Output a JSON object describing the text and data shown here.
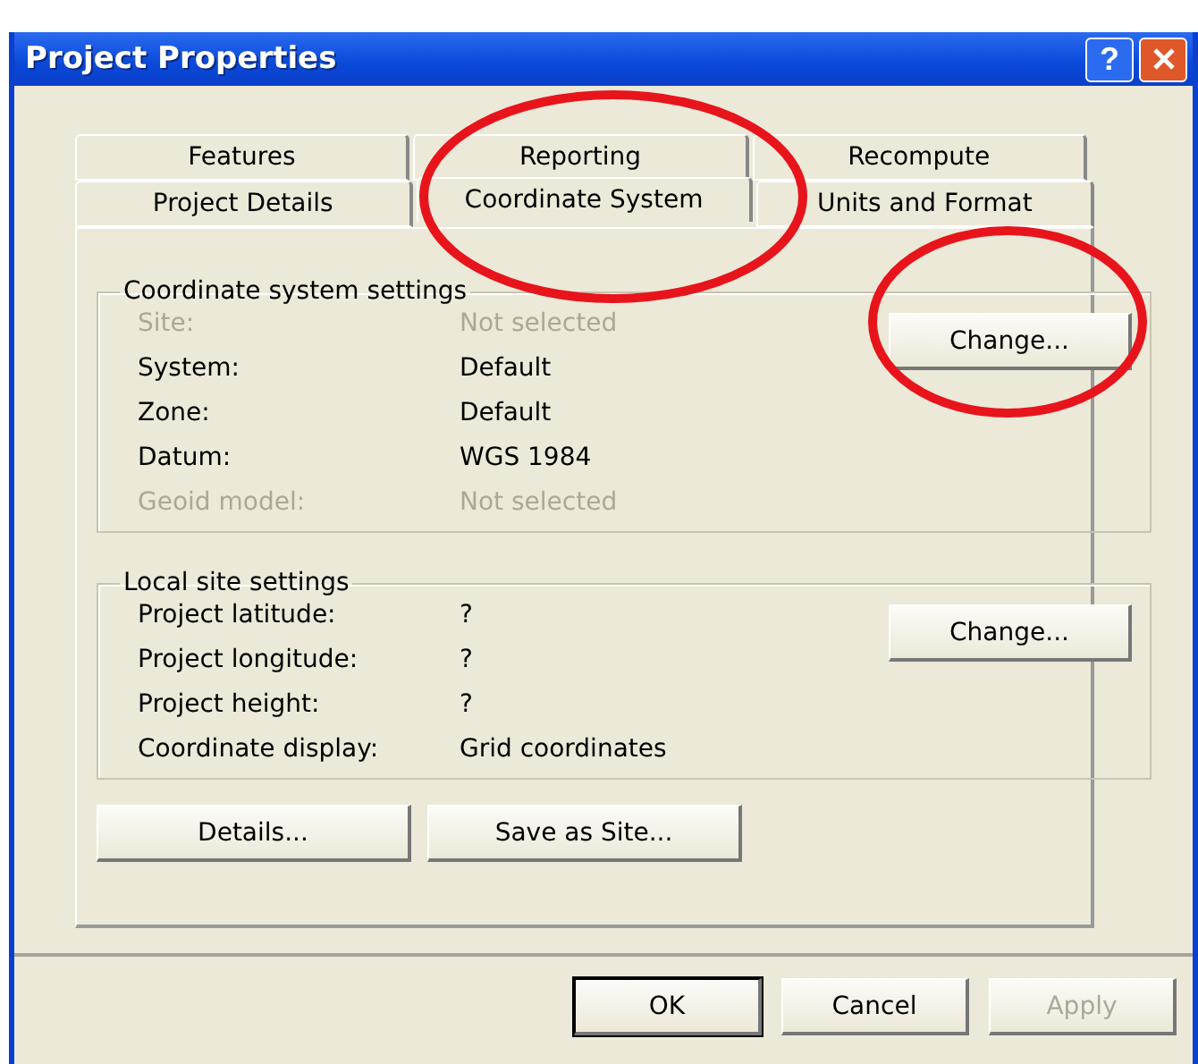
{
  "window": {
    "title": "Project Properties",
    "controls": [
      {
        "kind": "help",
        "label": "?"
      },
      {
        "kind": "close"
      }
    ]
  },
  "tab_rows": [
    [
      {
        "label": "Features",
        "selected": false
      },
      {
        "label": "Reporting",
        "selected": false
      },
      {
        "label": "Recompute",
        "selected": false
      }
    ],
    [
      {
        "label": "Project Details",
        "selected": false
      },
      {
        "label": "Coordinate System",
        "selected": true
      },
      {
        "label": "Units and Format",
        "selected": false
      }
    ]
  ],
  "groups": [
    {
      "title": "Coordinate system settings",
      "button": "Change...",
      "rows": [
        {
          "label": "Site:",
          "value": "Not selected",
          "disabled": true
        },
        {
          "label": "System:",
          "value": "Default",
          "disabled": false
        },
        {
          "label": "Zone:",
          "value": "Default",
          "disabled": false
        },
        {
          "label": "Datum:",
          "value": "WGS 1984",
          "disabled": false
        },
        {
          "label": "Geoid model:",
          "value": "Not selected",
          "disabled": true
        }
      ]
    },
    {
      "title": "Local site settings",
      "button": "Change...",
      "rows": [
        {
          "label": "Project latitude:",
          "value": "?",
          "disabled": false
        },
        {
          "label": "Project longitude:",
          "value": "?",
          "disabled": false
        },
        {
          "label": "Project height:",
          "value": "?",
          "disabled": false
        },
        {
          "label": "Coordinate display:",
          "value": "Grid coordinates",
          "disabled": false
        }
      ]
    }
  ],
  "panel_buttons": [
    "Details...",
    "Save as Site..."
  ],
  "dialog_buttons": [
    {
      "label": "OK",
      "default": true,
      "disabled": false
    },
    {
      "label": "Cancel",
      "default": false,
      "disabled": false
    },
    {
      "label": "Apply",
      "default": false,
      "disabled": true
    }
  ],
  "annotations": [
    {
      "kind": "ellipse"
    },
    {
      "kind": "ellipse"
    }
  ]
}
